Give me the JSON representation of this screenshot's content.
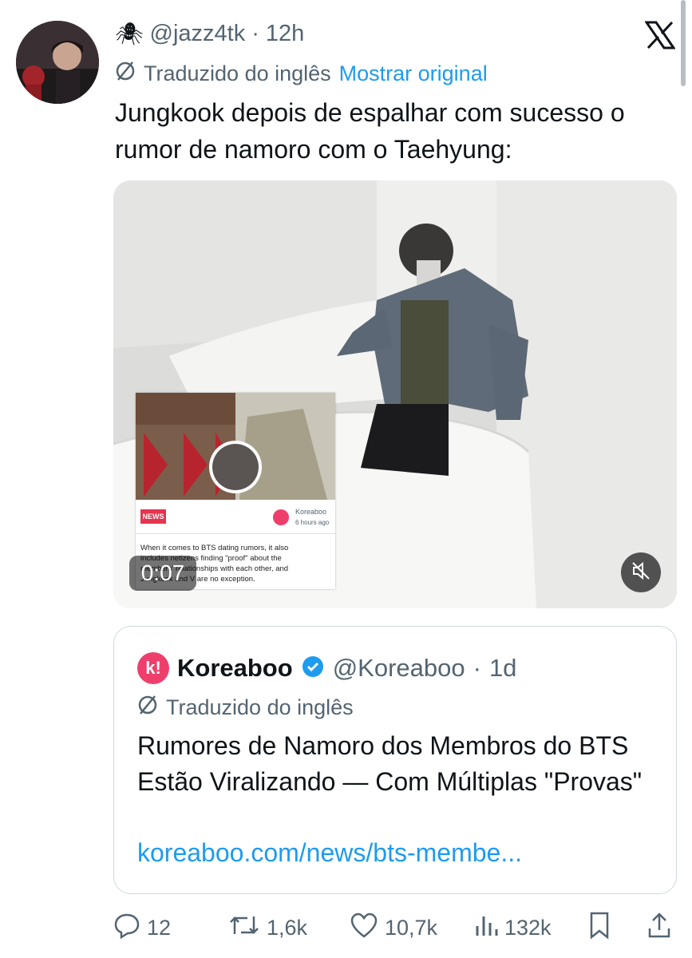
{
  "post": {
    "spider_emoji": "🕷",
    "handle": "@jazz4tk",
    "separator": "·",
    "time": "12h",
    "translated_label": "Traduzido do inglês",
    "show_original": "Mostrar original",
    "text": "Jungkook depois de espalhar com sucesso o rumor de namoro com o Taehyung:"
  },
  "video": {
    "duration": "0:07",
    "embedded_card": {
      "badge": "NEWS",
      "source": "Koreaboo",
      "time": "6 hours ago",
      "snippet": "When it comes to BTS dating rumors, it also includes netizens finding \"proof\" about the members' relationships with each other, and Jungkook and V are no exception."
    }
  },
  "quote": {
    "logo_letter": "k!",
    "name": "Koreaboo",
    "handle": "@Koreaboo",
    "separator": "·",
    "time": "1d",
    "translated_label": "Traduzido do inglês",
    "text": "Rumores de Namoro dos Membros do BTS Estão Viralizando — Com Múltiplas \"Provas\"",
    "link": "koreaboo.com/news/bts-membe..."
  },
  "actions": {
    "replies": "12",
    "reposts": "1,6k",
    "likes": "10,7k",
    "views": "132k"
  },
  "colors": {
    "accent": "#1d9bf0",
    "muted": "#536471",
    "text": "#0f1419",
    "brand_koreaboo": "#ee3f6c"
  }
}
